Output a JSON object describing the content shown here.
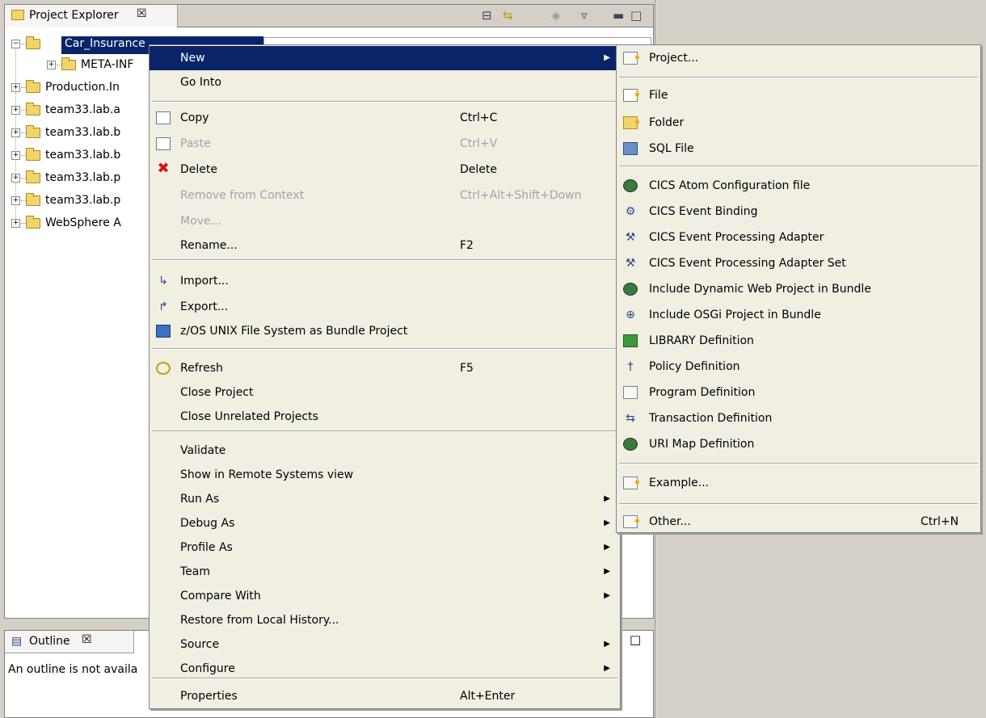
{
  "project_explorer": {
    "title": "Project Explorer",
    "close_glyph": "☒",
    "tree": [
      {
        "label": "Car_Insurance",
        "expander": "−",
        "selected": true
      },
      {
        "label": "META-INF",
        "expander": "+"
      },
      {
        "label": "Production.In",
        "expander": "+"
      },
      {
        "label": "team33.lab.a",
        "expander": "+"
      },
      {
        "label": "team33.lab.b",
        "expander": "+"
      },
      {
        "label": "team33.lab.b",
        "expander": "+"
      },
      {
        "label": "team33.lab.p",
        "expander": "+"
      },
      {
        "label": "team33.lab.p",
        "expander": "+"
      },
      {
        "label": "WebSphere A",
        "expander": "+"
      }
    ]
  },
  "outline": {
    "title": "Outline",
    "close_glyph": "☒",
    "message": "An outline is not availa"
  },
  "context_menu": {
    "items": [
      {
        "label": "New",
        "submenu": true,
        "highlighted": true
      },
      {
        "label": "Go Into"
      },
      {
        "label": "Copy",
        "accel": "Ctrl+C",
        "icon": "copy-icon"
      },
      {
        "label": "Paste",
        "accel": "Ctrl+V",
        "disabled": true,
        "icon": "paste-icon"
      },
      {
        "label": "Delete",
        "accel": "Delete",
        "icon": "delete-icon"
      },
      {
        "label": "Remove from Context",
        "accel": "Ctrl+Alt+Shift+Down",
        "disabled": true
      },
      {
        "label": "Move...",
        "disabled": true
      },
      {
        "label": "Rename...",
        "accel": "F2"
      },
      {
        "label": "Import...",
        "icon": "import-icon"
      },
      {
        "label": "Export...",
        "icon": "export-icon"
      },
      {
        "label": "z/OS UNIX File System as Bundle Project",
        "icon": "zos-icon"
      },
      {
        "label": "Refresh",
        "accel": "F5",
        "icon": "refresh-icon"
      },
      {
        "label": "Close Project"
      },
      {
        "label": "Close Unrelated Projects"
      },
      {
        "label": "Validate"
      },
      {
        "label": "Show in Remote Systems view"
      },
      {
        "label": "Run As",
        "submenu": true
      },
      {
        "label": "Debug As",
        "submenu": true
      },
      {
        "label": "Profile As",
        "submenu": true
      },
      {
        "label": "Team",
        "submenu": true
      },
      {
        "label": "Compare With",
        "submenu": true
      },
      {
        "label": "Restore from Local History..."
      },
      {
        "label": "Source",
        "submenu": true
      },
      {
        "label": "Configure",
        "submenu": true
      },
      {
        "label": "Properties",
        "accel": "Alt+Enter"
      }
    ]
  },
  "new_submenu": {
    "items": [
      {
        "label": "Project...",
        "icon": "new-project-icon"
      },
      {
        "label": "File",
        "icon": "new-file-icon"
      },
      {
        "label": "Folder",
        "icon": "new-folder-icon"
      },
      {
        "label": "SQL File",
        "icon": "sql-file-icon"
      },
      {
        "label": "CICS Atom Configuration file",
        "icon": "atom-config-icon"
      },
      {
        "label": "CICS Event Binding",
        "icon": "event-binding-icon"
      },
      {
        "label": "CICS Event Processing Adapter",
        "icon": "epadapter-icon"
      },
      {
        "label": "CICS Event Processing Adapter Set",
        "icon": "epadapter-set-icon"
      },
      {
        "label": "Include Dynamic Web Project in Bundle",
        "icon": "dynamic-web-icon"
      },
      {
        "label": "Include OSGi Project in Bundle",
        "icon": "osgi-icon"
      },
      {
        "label": "LIBRARY Definition",
        "icon": "library-icon"
      },
      {
        "label": "Policy Definition",
        "icon": "policy-icon"
      },
      {
        "label": "Program Definition",
        "icon": "program-icon"
      },
      {
        "label": "Transaction Definition",
        "icon": "transaction-icon"
      },
      {
        "label": "URI Map Definition",
        "icon": "urimap-icon"
      },
      {
        "label": "Example...",
        "icon": "example-icon"
      },
      {
        "label": "Other...",
        "accel": "Ctrl+N",
        "icon": "other-icon"
      }
    ]
  }
}
